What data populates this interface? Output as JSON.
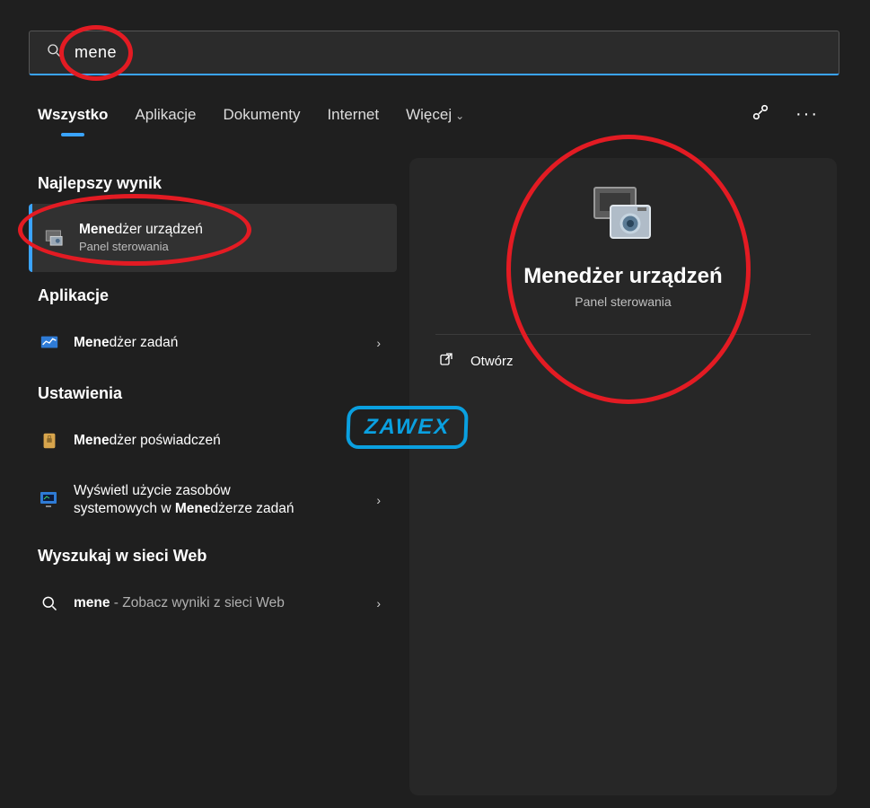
{
  "search": {
    "query": "mene",
    "placeholder": ""
  },
  "tabs": {
    "all": "Wszystko",
    "apps": "Aplikacje",
    "docs": "Dokumenty",
    "web": "Internet",
    "more": "Więcej"
  },
  "sections": {
    "best": "Najlepszy wynik",
    "apps": "Aplikacje",
    "settings": "Ustawienia",
    "websearch": "Wyszukaj w sieci Web"
  },
  "results": {
    "deviceManager": {
      "bold": "Mene",
      "rest": "dżer urządzeń",
      "sub": "Panel sterowania"
    },
    "taskManager": {
      "bold": "Mene",
      "rest": "dżer zadań"
    },
    "credentialManager": {
      "bold": "Mene",
      "rest": "dżer poświadczeń"
    },
    "resourceUsage": {
      "line1": "Wyświetl użycie zasobów",
      "line2a": "systemowych w ",
      "line2b_bold": "Mene",
      "line2c": "dżerze zadań"
    },
    "web": {
      "query": "mene",
      "suffix": " - Zobacz wyniki z sieci Web"
    }
  },
  "preview": {
    "title": "Menedżer urządzeń",
    "sub": "Panel sterowania",
    "open": "Otwórz"
  },
  "watermark": "ZAWEX"
}
